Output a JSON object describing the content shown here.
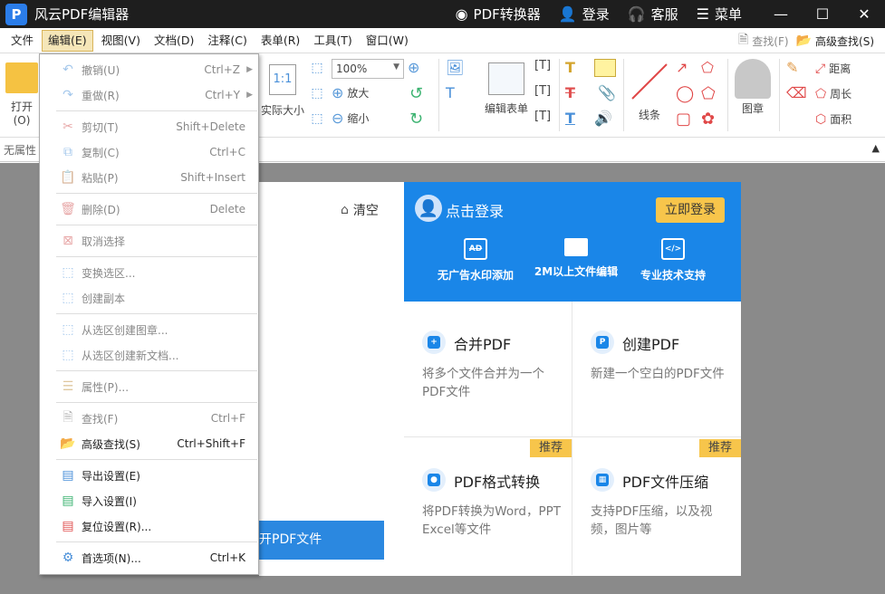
{
  "titlebar": {
    "app_title": "风云PDF编辑器",
    "logo_letter": "P",
    "converter": "PDF转换器",
    "login": "登录",
    "service": "客服",
    "menu": "菜单"
  },
  "menubar": {
    "items": [
      "文件",
      "编辑(E)",
      "视图(V)",
      "文档(D)",
      "注释(C)",
      "表单(R)",
      "工具(T)",
      "窗口(W)"
    ],
    "find": "查找(F)",
    "advanced_find": "高级查找(S)"
  },
  "toolbar": {
    "open": "打开(O)",
    "actual_size": "实际大小",
    "zoom_value": "100%",
    "zoom_in": "放大",
    "zoom_out": "缩小",
    "edit_form": "编辑表单",
    "lines": "线条",
    "stamp": "图章",
    "distance": "距离",
    "perimeter": "周长",
    "area": "面积"
  },
  "propbar": {
    "label": "无属性"
  },
  "start_page": {
    "clear": "清空",
    "open_pdf": "打开PDF文件",
    "click_login": "点击登录",
    "login_now": "立即登录",
    "features": [
      {
        "icon": "AD",
        "label": "无广告水印添加"
      },
      {
        "icon": "",
        "label": "2M以上文件编辑"
      },
      {
        "icon": "</>",
        "label": "专业技术支持"
      }
    ],
    "tiles": [
      {
        "title": "合并PDF",
        "desc": "将多个文件合并为一个PDF文件",
        "badge": ""
      },
      {
        "title": "创建PDF",
        "desc": "新建一个空白的PDF文件",
        "badge": ""
      },
      {
        "title": "PDF格式转换",
        "desc": "将PDF转换为Word，PPT Excel等文件",
        "badge": "推荐"
      },
      {
        "title": "PDF文件压缩",
        "desc": "支持PDF压缩，以及视频，图片等",
        "badge": "推荐"
      }
    ]
  },
  "edit_menu": {
    "items": [
      {
        "label": "撤销(U)",
        "shortcut": "Ctrl+Z",
        "disabled": true,
        "submenu": true
      },
      {
        "label": "重做(R)",
        "shortcut": "Ctrl+Y",
        "disabled": true,
        "submenu": true
      },
      {
        "label": "剪切(T)",
        "shortcut": "Shift+Delete",
        "disabled": true
      },
      {
        "label": "复制(C)",
        "shortcut": "Ctrl+C",
        "disabled": true
      },
      {
        "label": "粘贴(P)",
        "shortcut": "Shift+Insert",
        "disabled": true
      },
      {
        "label": "删除(D)",
        "shortcut": "Delete",
        "disabled": true
      },
      {
        "label": "取消选择",
        "shortcut": "",
        "disabled": true
      },
      {
        "label": "变换选区...",
        "shortcut": "",
        "disabled": true
      },
      {
        "label": "创建副本",
        "shortcut": "",
        "disabled": true
      },
      {
        "label": "从选区创建图章...",
        "shortcut": "",
        "disabled": true
      },
      {
        "label": "从选区创建新文档...",
        "shortcut": "",
        "disabled": true
      },
      {
        "label": "属性(P)...",
        "shortcut": "",
        "disabled": true
      },
      {
        "label": "查找(F)",
        "shortcut": "Ctrl+F",
        "disabled": true
      },
      {
        "label": "高级查找(S)",
        "shortcut": "Ctrl+Shift+F",
        "disabled": false
      },
      {
        "label": "导出设置(E)",
        "shortcut": "",
        "disabled": false
      },
      {
        "label": "导入设置(I)",
        "shortcut": "",
        "disabled": false
      },
      {
        "label": "复位设置(R)...",
        "shortcut": "",
        "disabled": false
      },
      {
        "label": "首选项(N)...",
        "shortcut": "Ctrl+K",
        "disabled": false
      }
    ]
  },
  "colors": {
    "accent": "#1a86e8",
    "badge": "#f7c54b",
    "titlebar": "#1e1e1e",
    "canvas": "#8a8a8a"
  }
}
